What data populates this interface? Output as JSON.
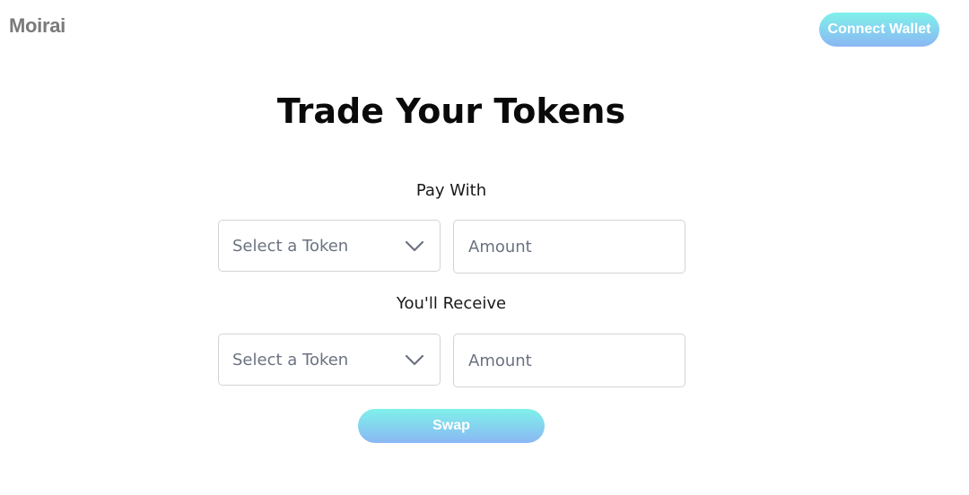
{
  "header": {
    "brand": "Moirai",
    "connect_wallet_label": "Connect Wallet"
  },
  "main": {
    "title": "Trade Your Tokens",
    "pay": {
      "label": "Pay With",
      "token_select": "Select a Token",
      "amount_placeholder": "Amount",
      "amount_value": ""
    },
    "receive": {
      "label": "You'll Receive",
      "token_select": "Select a Token",
      "amount_placeholder": "Amount",
      "amount_value": ""
    },
    "swap_label": "Swap"
  },
  "icons": {
    "dropdown": "chevron-down-icon"
  },
  "colors": {
    "button_gradient_top": "#7ff1ea",
    "button_gradient_bottom": "#8ab7f4",
    "brand_text": "#7a7a7a",
    "placeholder_text": "#6b7280",
    "field_border": "#d4d4d8"
  }
}
